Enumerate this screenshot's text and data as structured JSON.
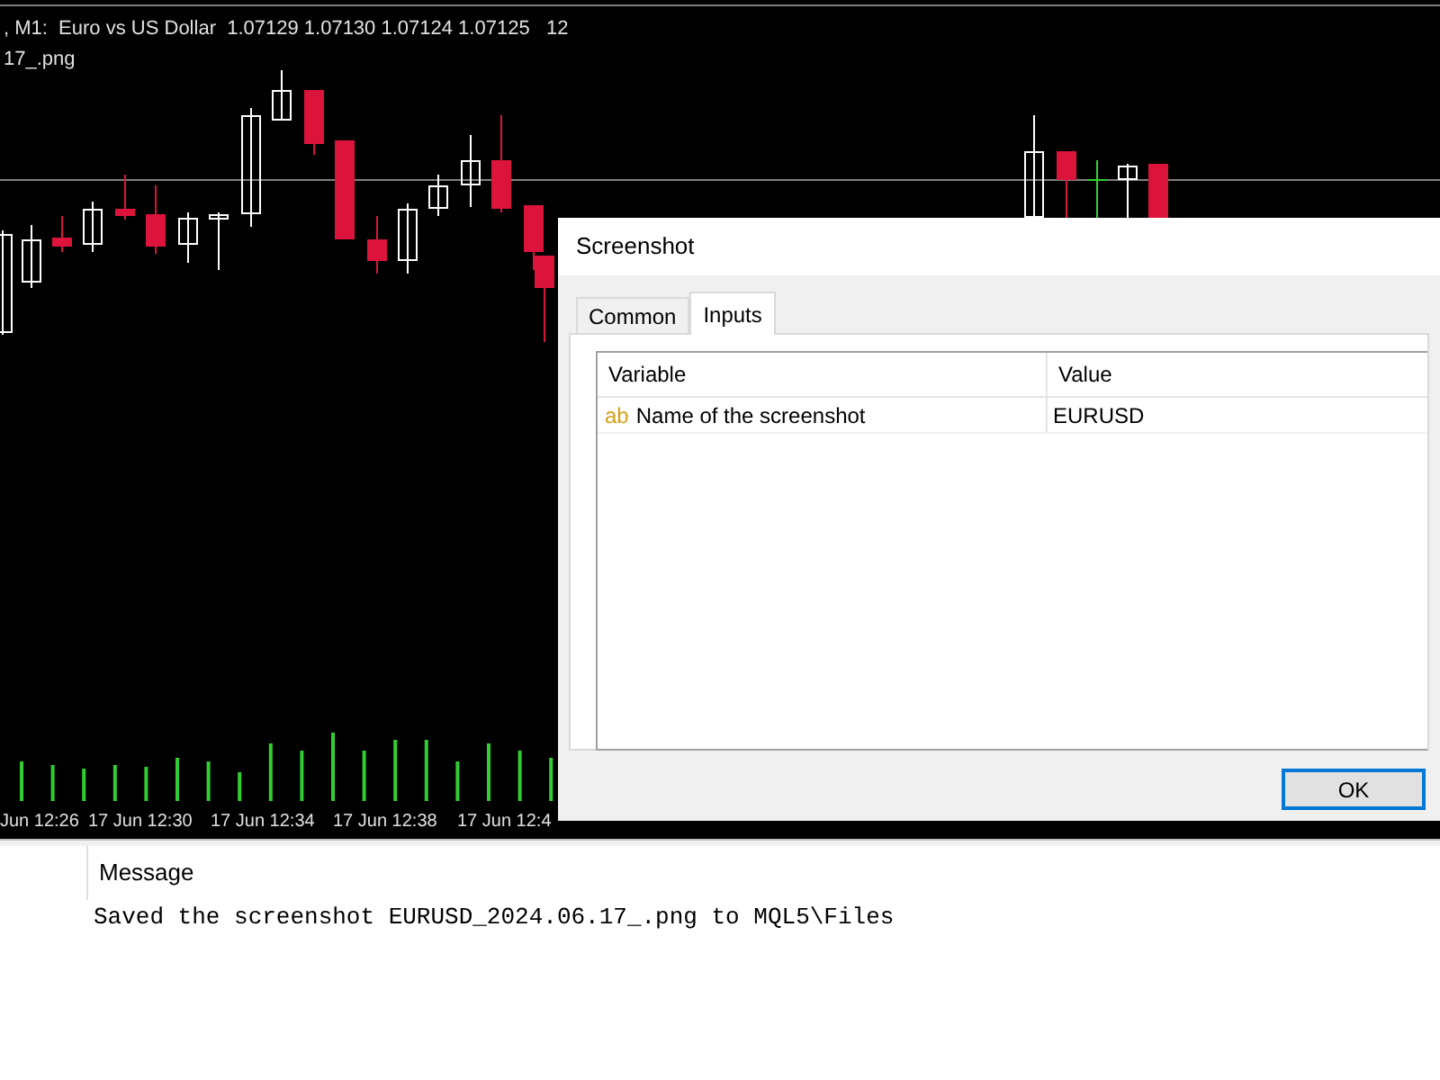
{
  "chart": {
    "header": ", M1:  Euro vs US Dollar  1.07129 1.07130 1.07124 1.07125   12",
    "subheader": "17_.png",
    "time_labels": [
      "Jun 12:26",
      "17 Jun 12:30",
      "17 Jun 12:34",
      "17 Jun 12:38",
      "17 Jun 12:4"
    ]
  },
  "dialog": {
    "title": "Screenshot",
    "tabs": [
      {
        "label": "Common",
        "selected": false
      },
      {
        "label": "Inputs",
        "selected": true
      }
    ],
    "table": {
      "columns": [
        "Variable",
        "Value"
      ],
      "rows": [
        {
          "type_badge": "ab",
          "variable": "Name of the screenshot",
          "value": "EURUSD"
        }
      ]
    },
    "buttons": [
      "OK"
    ]
  },
  "log": {
    "columns": [
      "Message"
    ],
    "rows": [
      "Saved the screenshot EURUSD_2024.06.17_.png to MQL5\\Files"
    ]
  }
}
